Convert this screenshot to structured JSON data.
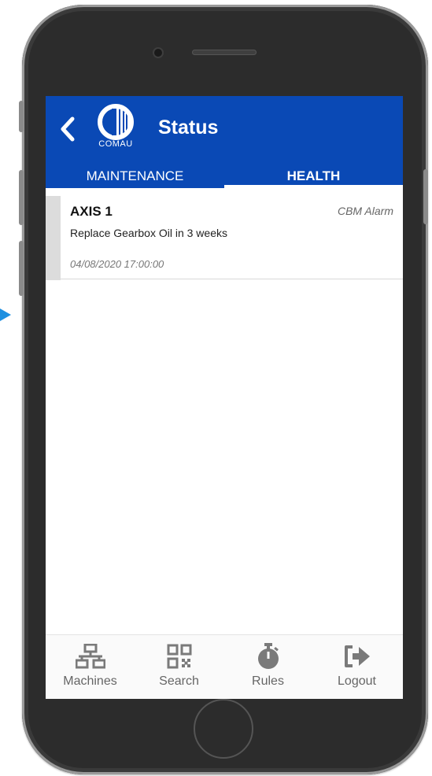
{
  "app": {
    "title": "Status",
    "logo_text": "COMAU"
  },
  "tabs": [
    {
      "label": "MAINTENANCE",
      "active": false
    },
    {
      "label": "HEALTH",
      "active": true
    }
  ],
  "alerts": [
    {
      "axis": "AXIS 1",
      "type": "CBM Alarm",
      "message": "Replace Gearbox Oil in 3 weeks",
      "timestamp": "04/08/2020 17:00:00"
    }
  ],
  "bottom_nav": [
    {
      "label": "Machines",
      "icon": "network-icon"
    },
    {
      "label": "Search",
      "icon": "qr-code-icon"
    },
    {
      "label": "Rules",
      "icon": "stopwatch-icon"
    },
    {
      "label": "Logout",
      "icon": "logout-icon"
    }
  ],
  "colors": {
    "primary": "#0a49b5",
    "icon_gray": "#7a7a7a",
    "card_accent": "#dcdcdc"
  }
}
